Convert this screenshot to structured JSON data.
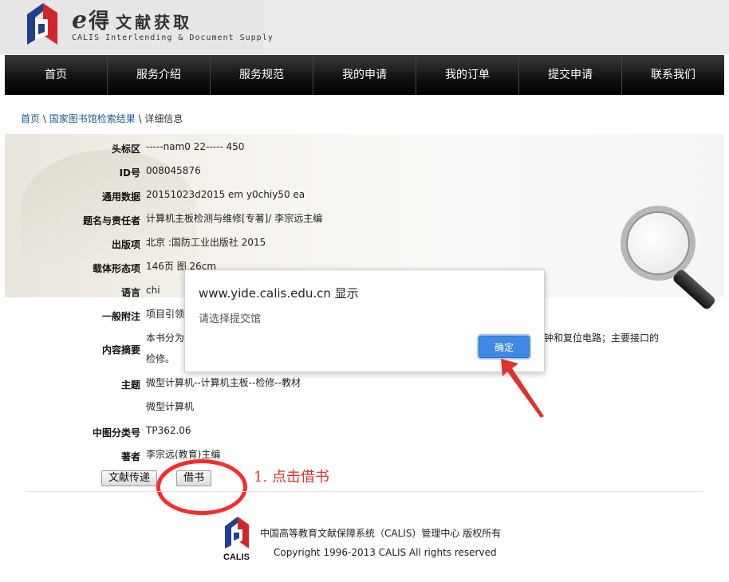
{
  "header": {
    "logo_e": "e",
    "logo_de": "得",
    "logo_cn": "文献获取",
    "logo_en": "CALIS Interlending & Document Supply"
  },
  "nav": [
    "首页",
    "服务介绍",
    "服务规范",
    "我的申请",
    "我的订单",
    "提交申请",
    "联系我们"
  ],
  "breadcrumb": {
    "home": "首页",
    "sep1": " \\ ",
    "results": "国家图书馆检索结果",
    "sep2": " \\ ",
    "current": "详细信息"
  },
  "record": [
    {
      "label": "头标区",
      "value": "-----nam0 22----- 450"
    },
    {
      "label": "ID号",
      "value": "008045876"
    },
    {
      "label": "通用数据",
      "value": "20151023d2015 em y0chiy50 ea"
    },
    {
      "label": "题名与责任者",
      "value": "计算机主板检测与维修[专著]/ 李宗远主编"
    },
    {
      "label": "出版项",
      "value": "北京 :国防工业出版社 2015"
    },
    {
      "label": "载体形态项",
      "value": "146页 图 26cm"
    },
    {
      "label": "语言",
      "value": "chi"
    },
    {
      "label": "一般附注",
      "value": "项目引领"
    },
    {
      "label": "内容摘要",
      "value": "本书分为",
      "value_right": "钟和复位电路；主要接口的",
      "value_line2": "检修。"
    },
    {
      "label": "主题",
      "value": "微型计算机--计算机主板--检修--教材"
    },
    {
      "label": "",
      "value": "微型计算机"
    },
    {
      "label": "中图分类号",
      "value": "TP362.06"
    },
    {
      "label": "著者",
      "value": "李宗远(教育)主编"
    }
  ],
  "buttons": {
    "delivery": "文献传递",
    "borrow": "借书"
  },
  "annotation": "1. 点击借书",
  "footer": {
    "line1": "中国高等教育文献保障系统（CALIS）管理中心 版权所有",
    "line2": "Copyright 1996-2013 CALIS All rights reserved",
    "logo_text": "CALIS"
  },
  "dialog": {
    "title": "www.yide.calis.edu.cn 显示",
    "message": "请选择提交馆",
    "ok": "确定"
  },
  "colors": {
    "accent_red": "#e0312a",
    "link_blue": "#1a5c99",
    "dialog_button": "#3f8ae3"
  }
}
